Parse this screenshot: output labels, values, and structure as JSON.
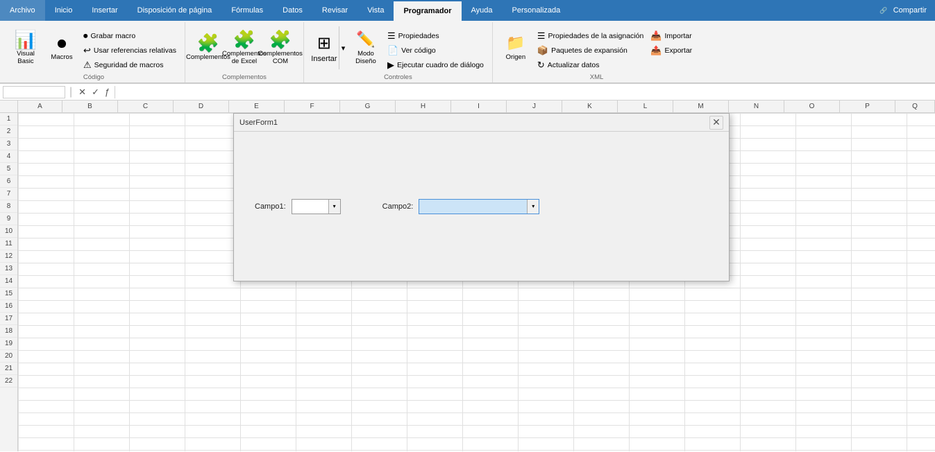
{
  "ribbon": {
    "tabs": [
      {
        "id": "archivo",
        "label": "Archivo"
      },
      {
        "id": "inicio",
        "label": "Inicio"
      },
      {
        "id": "insertar",
        "label": "Insertar"
      },
      {
        "id": "disposicion",
        "label": "Disposición de página"
      },
      {
        "id": "formulas",
        "label": "Fórmulas"
      },
      {
        "id": "datos",
        "label": "Datos"
      },
      {
        "id": "revisar",
        "label": "Revisar"
      },
      {
        "id": "vista",
        "label": "Vista"
      },
      {
        "id": "programador",
        "label": "Programador"
      },
      {
        "id": "ayuda",
        "label": "Ayuda"
      },
      {
        "id": "personalizada",
        "label": "Personalizada"
      }
    ],
    "active_tab": "programador",
    "groups": [
      {
        "id": "codigo",
        "label": "Código",
        "items": [
          {
            "type": "btn-large",
            "id": "visual-basic",
            "icon": "📊",
            "label": "Visual\nBasic"
          },
          {
            "type": "btn-large",
            "id": "macros",
            "icon": "⏺",
            "label": "Macros"
          },
          {
            "type": "col",
            "items": [
              {
                "type": "btn-small",
                "id": "grabar-macro",
                "icon": "⏺",
                "label": "Grabar macro"
              },
              {
                "type": "btn-small",
                "id": "usar-referencias",
                "icon": "↩",
                "label": "Usar referencias relativas"
              },
              {
                "type": "btn-small",
                "id": "seguridad-macros",
                "icon": "⚠",
                "label": "Seguridad de macros"
              }
            ]
          }
        ]
      },
      {
        "id": "complementos",
        "label": "Complementos",
        "items": [
          {
            "type": "btn-large",
            "id": "complementos",
            "icon": "🧩",
            "label": "Complementos"
          },
          {
            "type": "btn-large",
            "id": "complementos-excel",
            "icon": "🧩",
            "label": "Complementos\nde Excel"
          },
          {
            "type": "btn-large",
            "id": "complementos-com",
            "icon": "🧩",
            "label": "Complementos\nCOM"
          }
        ]
      },
      {
        "id": "controles",
        "label": "Controles",
        "items": [
          {
            "type": "btn-split",
            "id": "insertar",
            "icon": "⊞",
            "label": "Insertar"
          },
          {
            "type": "btn-large",
            "id": "modo-diseno",
            "icon": "✏",
            "label": "Modo\nDiseño"
          },
          {
            "type": "col",
            "items": [
              {
                "type": "btn-small",
                "id": "propiedades",
                "icon": "☰",
                "label": "Propiedades"
              },
              {
                "type": "btn-small",
                "id": "ver-codigo",
                "icon": "📄",
                "label": "Ver código"
              },
              {
                "type": "btn-small",
                "id": "ejecutar-cuadro",
                "icon": "▶",
                "label": "Ejecutar cuadro de diálogo"
              }
            ]
          }
        ]
      },
      {
        "id": "xml",
        "label": "XML",
        "items": [
          {
            "type": "btn-large",
            "id": "origen",
            "icon": "📁",
            "label": "Origen"
          },
          {
            "type": "col",
            "items": [
              {
                "type": "btn-small",
                "id": "propiedades-asignacion",
                "icon": "☰",
                "label": "Propiedades de la asignación"
              },
              {
                "type": "btn-small",
                "id": "paquetes-expansion",
                "icon": "📦",
                "label": "Paquetes de expansión"
              },
              {
                "type": "btn-small",
                "id": "actualizar-datos",
                "icon": "↻",
                "label": "Actualizar datos"
              }
            ]
          },
          {
            "type": "col",
            "items": [
              {
                "type": "btn-small",
                "id": "importar",
                "icon": "📥",
                "label": "Importar"
              },
              {
                "type": "btn-small",
                "id": "exportar",
                "icon": "📤",
                "label": "Exportar"
              }
            ]
          }
        ]
      }
    ]
  },
  "formula_bar": {
    "name_box": "",
    "formula": ""
  },
  "columns": [
    "A",
    "B",
    "C",
    "D",
    "E",
    "F",
    "G",
    "H",
    "I",
    "J",
    "K",
    "L",
    "M",
    "N",
    "O",
    "P",
    "Q"
  ],
  "rows": [
    1,
    2,
    3,
    4,
    5,
    6,
    7,
    8,
    9,
    10,
    11,
    12,
    13,
    14,
    15,
    16,
    17,
    18,
    19,
    20,
    21,
    22
  ],
  "share_button": "Compartir",
  "modal": {
    "title": "UserForm1",
    "campo1_label": "Campo1:",
    "campo2_label": "Campo2:"
  }
}
